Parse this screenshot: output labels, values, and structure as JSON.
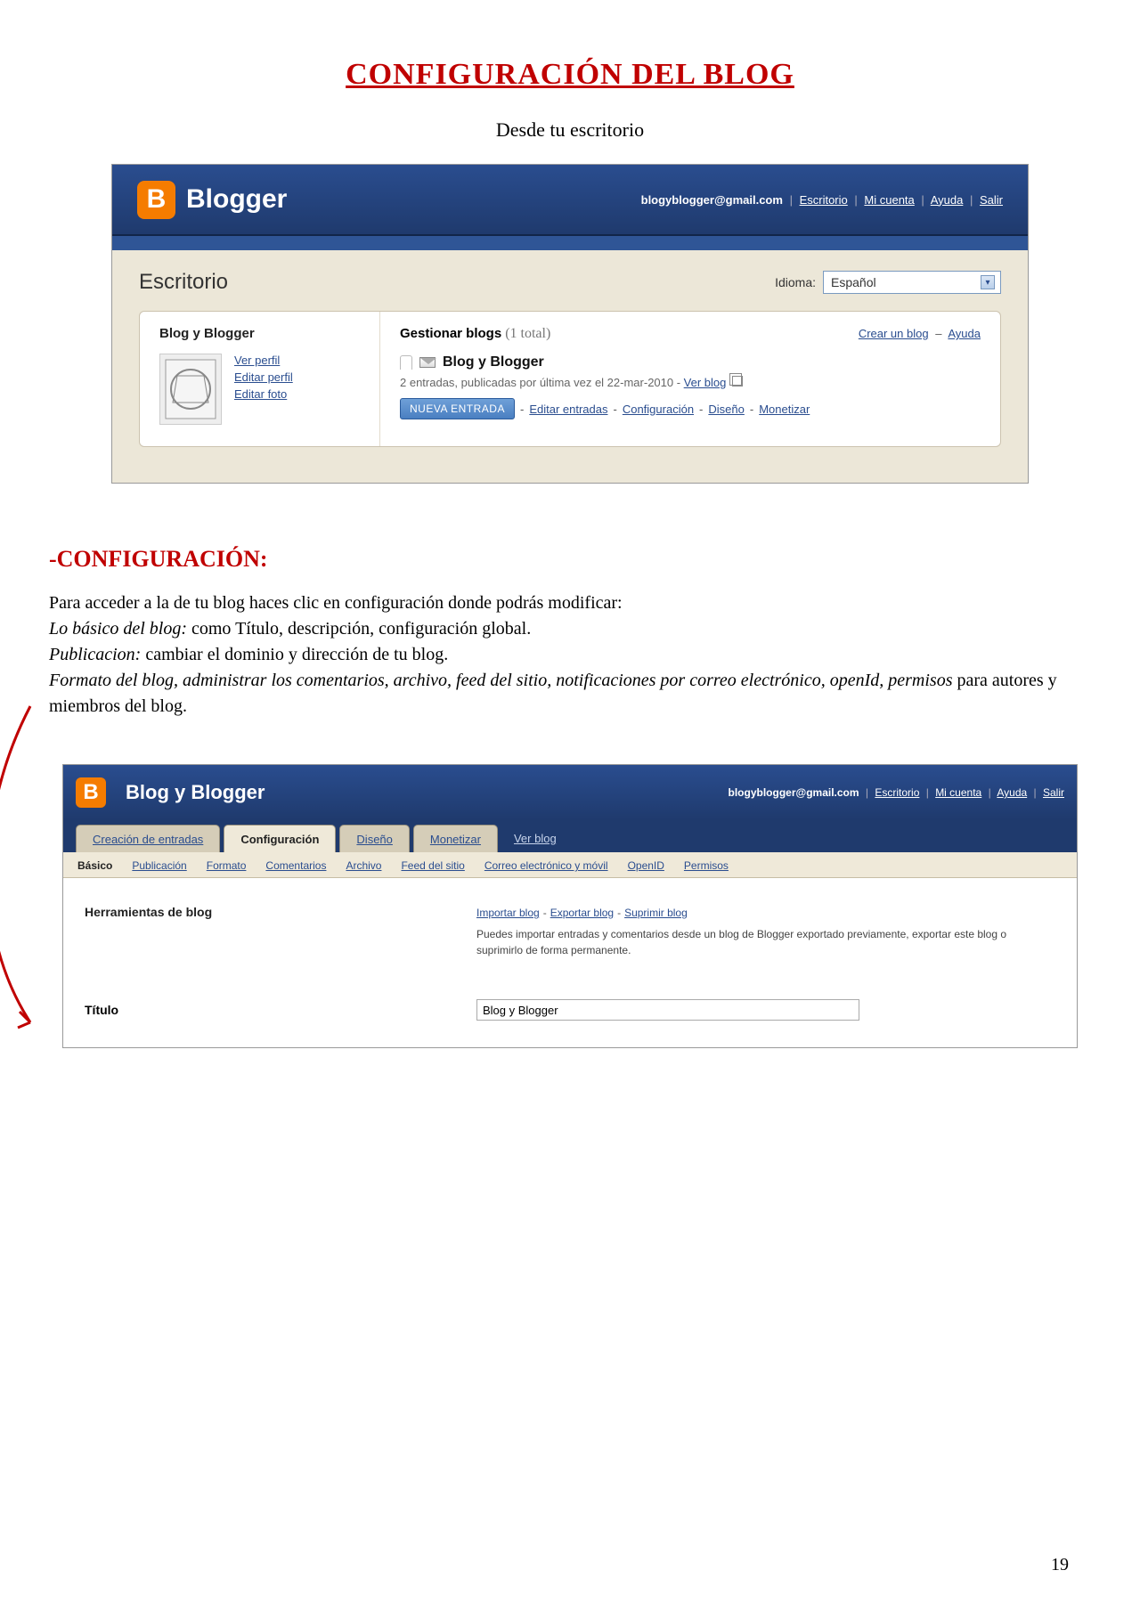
{
  "doc": {
    "title": "CONFIGURACIÓN DEL BLOG",
    "subtitle": "Desde tu escritorio",
    "page_number": "19"
  },
  "shot1": {
    "brand": "Blogger",
    "logo_letter": "B",
    "top": {
      "email": "blogyblogger@gmail.com",
      "links": {
        "escritorio": "Escritorio",
        "micuenta": "Mi cuenta",
        "ayuda": "Ayuda",
        "salir": "Salir"
      }
    },
    "escritorio_title": "Escritorio",
    "idioma_label": "Idioma:",
    "idioma_value": "Español",
    "left_title": "Blog y Blogger",
    "profile_links": {
      "ver": "Ver perfil",
      "editar": "Editar perfil",
      "foto": "Editar foto"
    },
    "right_head": {
      "gestionar": "Gestionar blogs",
      "count": "(1 total)",
      "crear": "Crear un blog",
      "ayuda": "Ayuda"
    },
    "blog_name": "Blog y Blogger",
    "blog_meta_prefix": "2 entradas, publicadas por última vez el 22-mar-2010 - ",
    "blog_meta_link": "Ver blog",
    "actions": {
      "nueva": "NUEVA ENTRADA",
      "editar": "Editar entradas",
      "config": "Configuración",
      "diseno": "Diseño",
      "monet": "Monetizar"
    }
  },
  "section": {
    "heading": "-CONFIGURACIÓN:",
    "line1": "Para acceder a la de tu blog haces clic en configuración donde podrás modificar:",
    "line2_em": "Lo básico del blog:",
    "line2_rest": " como Título, descripción, configuración global.",
    "line3_em": "Publicacion:",
    "line3_rest": " cambiar el dominio y dirección de tu blog.",
    "line4_em": "Formato del blog, administrar los comentarios, archivo, feed del sitio, notificaciones por correo electrónico, openId, permisos",
    "line4_rest": " para autores y miembros del blog."
  },
  "shot2": {
    "logo_letter": "B",
    "title": "Blog y Blogger",
    "top": {
      "email": "blogyblogger@gmail.com",
      "links": {
        "escritorio": "Escritorio",
        "micuenta": "Mi cuenta",
        "ayuda": "Ayuda",
        "salir": "Salir"
      }
    },
    "maintabs": {
      "creacion": "Creación de entradas",
      "config": "Configuración",
      "diseno": "Diseño",
      "monet": "Monetizar",
      "verblog": "Ver blog"
    },
    "subtabs": {
      "basico": "Básico",
      "publicacion": "Publicación",
      "formato": "Formato",
      "comentarios": "Comentarios",
      "archivo": "Archivo",
      "feed": "Feed del sitio",
      "correo": "Correo electrónico y móvil",
      "openid": "OpenID",
      "permisos": "Permisos"
    },
    "tools": {
      "label": "Herramientas de blog",
      "importar": "Importar blog",
      "exportar": "Exportar blog",
      "suprimir": "Suprimir blog",
      "desc": "Puedes importar entradas y comentarios desde un blog de Blogger exportado previamente, exportar este blog o suprimirlo de forma permanente."
    },
    "titulo": {
      "label": "Título",
      "value": "Blog y Blogger"
    }
  }
}
